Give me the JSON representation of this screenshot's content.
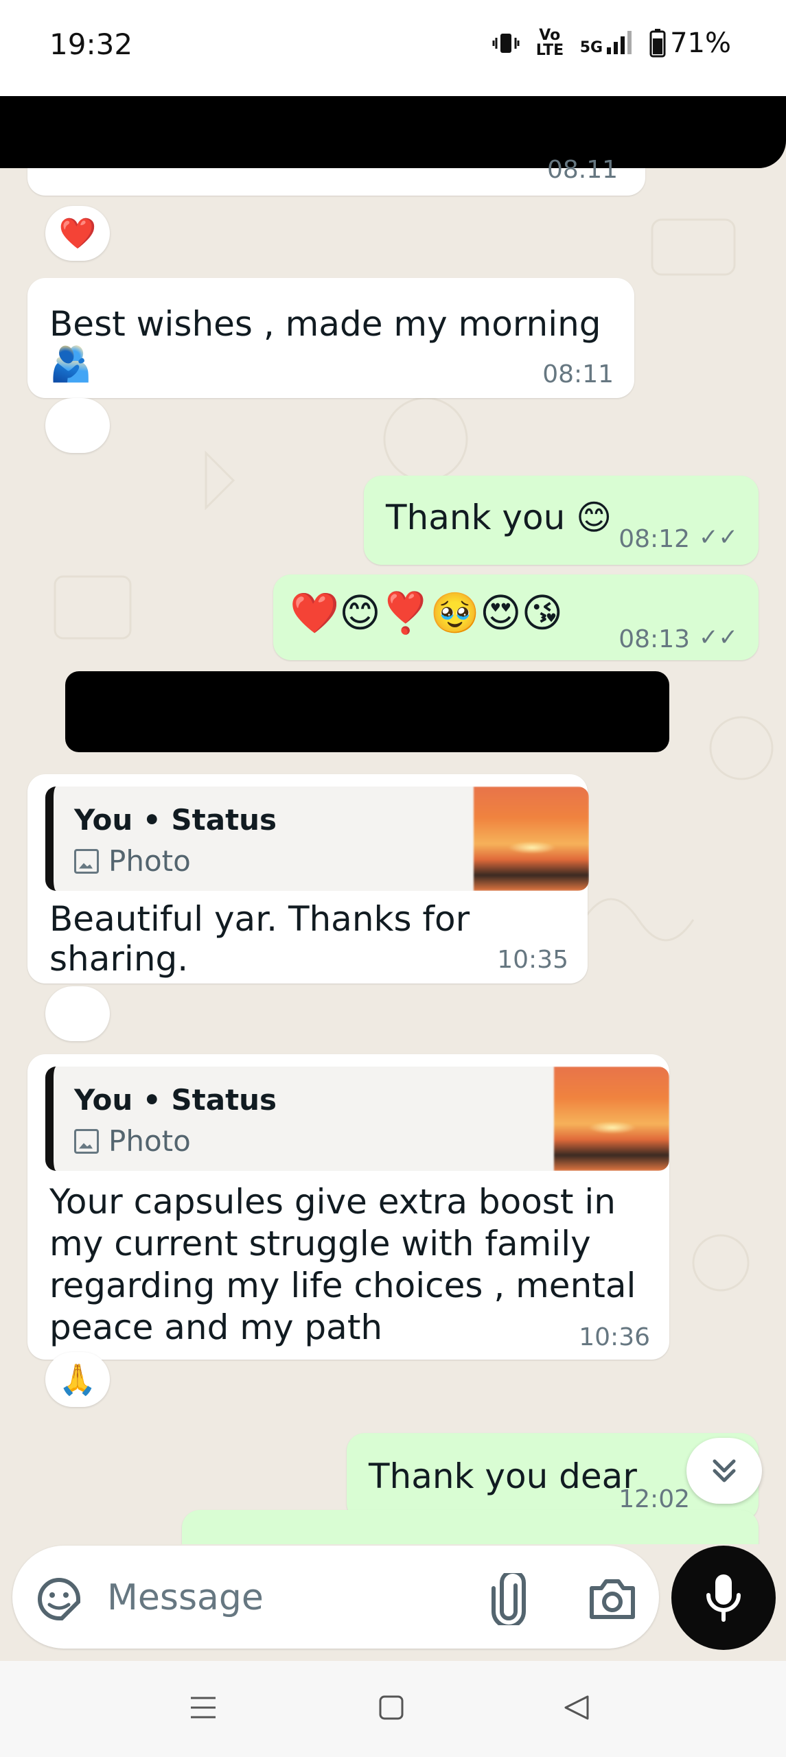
{
  "status_bar": {
    "time": "19:32",
    "network": "5G",
    "volte": "Vo LTE",
    "battery": "71%"
  },
  "chat": {
    "partial_time_top": "08.11",
    "messages": [
      {
        "dir": "in",
        "text": "Best wishes , made my morning 🫂",
        "time": "08:11"
      },
      {
        "dir": "out",
        "text": "Thank you 😊",
        "time": "08:12"
      },
      {
        "dir": "out",
        "text": "❤️😊❣️🥹😍😘",
        "time": "08:13"
      },
      {
        "dir": "in",
        "reply_title": "You • Status",
        "reply_sub": "Photo",
        "text": "Beautiful yar. Thanks for sharing.",
        "time": "10:35"
      },
      {
        "dir": "in",
        "reply_title": "You • Status",
        "reply_sub": "Photo",
        "text": "Your capsules give extra boost in my current struggle with family regarding my life choices , mental peace and my path",
        "time": "10:36"
      },
      {
        "dir": "out",
        "text": "Thank you dear",
        "time": "12:02"
      }
    ],
    "reactions": {
      "top": "❤️",
      "after_capsules": "🙏"
    }
  },
  "input": {
    "placeholder": "Message"
  },
  "colors": {
    "incoming": "#ffffff",
    "outgoing": "#d9fdd3",
    "chat_bg": "#efeae2",
    "mic_button": "#0b0b0b"
  }
}
